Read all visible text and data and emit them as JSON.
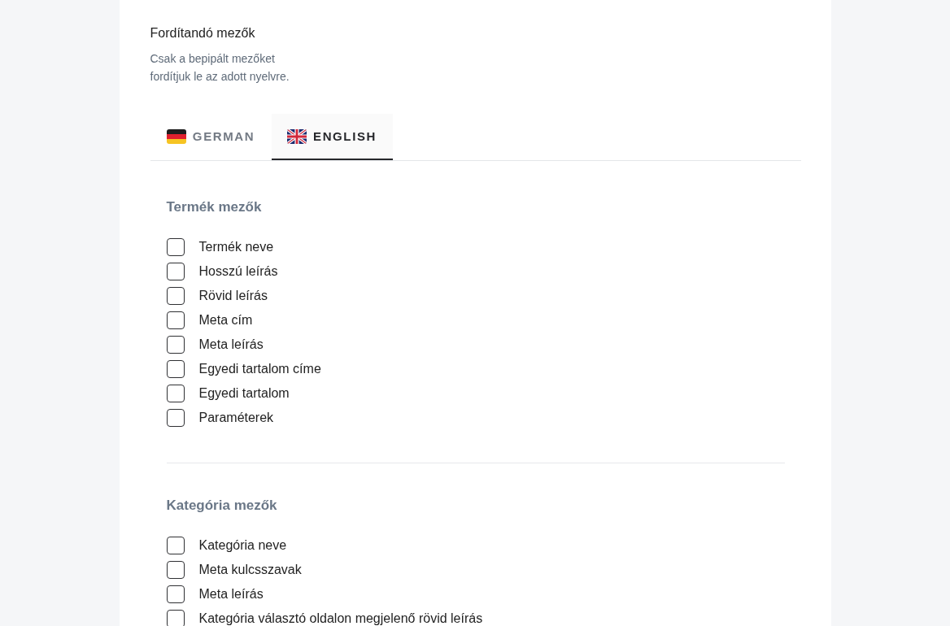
{
  "header": {
    "title": "Fordítandó mezők",
    "description": "Csak a bepipált mezőket fordítjuk le az adott nyelvre."
  },
  "tabs": [
    {
      "label": "GERMAN",
      "kind": "de",
      "selected": false
    },
    {
      "label": "ENGLISH",
      "kind": "gb",
      "selected": true
    }
  ],
  "sections": [
    {
      "title": "Termék mezők",
      "fields": [
        {
          "label": "Termék neve",
          "checked": false
        },
        {
          "label": "Hosszú leírás",
          "checked": false
        },
        {
          "label": "Rövid leírás",
          "checked": false
        },
        {
          "label": "Meta cím",
          "checked": false
        },
        {
          "label": "Meta leírás",
          "checked": false
        },
        {
          "label": "Egyedi tartalom címe",
          "checked": false
        },
        {
          "label": "Egyedi tartalom",
          "checked": false
        },
        {
          "label": "Paraméterek",
          "checked": false
        }
      ]
    },
    {
      "title": "Kategória mezők",
      "fields": [
        {
          "label": "Kategória neve",
          "checked": false
        },
        {
          "label": "Meta kulcsszavak",
          "checked": false
        },
        {
          "label": "Meta leírás",
          "checked": false
        },
        {
          "label": "Kategória választó oldalon megjelenő rövid leírás",
          "checked": false
        }
      ]
    }
  ]
}
